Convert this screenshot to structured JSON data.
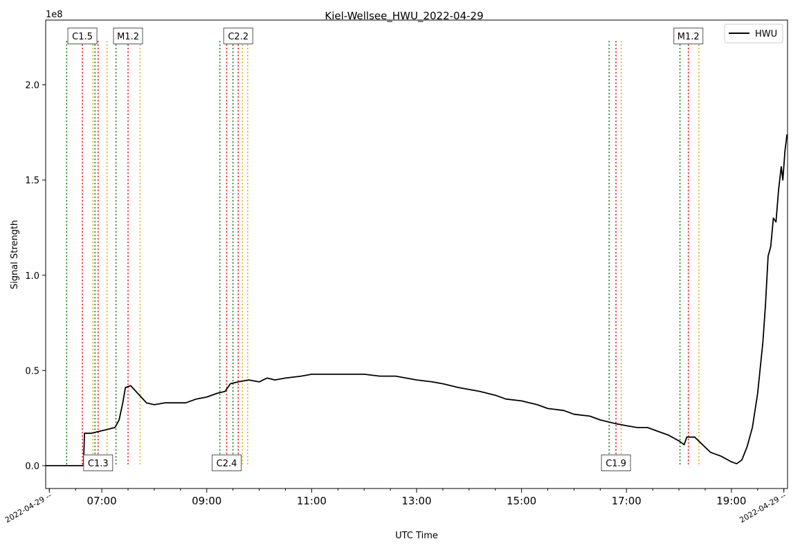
{
  "chart_data": {
    "type": "line",
    "title": "Kiel-Wellsee_HWU_2022-04-29",
    "xlabel": "UTC Time",
    "ylabel": "Signal Strength",
    "y_offset_label": "1e8",
    "xlim": [
      5.93,
      20.07
    ],
    "ylim": [
      -0.12,
      2.34
    ],
    "x_unit": "hour UTC",
    "y_unit": "1e8",
    "grid": false,
    "legend_position": "top-right",
    "x_ticks": [
      {
        "x": 7,
        "label": "07:00"
      },
      {
        "x": 9,
        "label": "09:00"
      },
      {
        "x": 11,
        "label": "11:00"
      },
      {
        "x": 13,
        "label": "13:00"
      },
      {
        "x": 15,
        "label": "15:00"
      },
      {
        "x": 17,
        "label": "17:00"
      },
      {
        "x": 19,
        "label": "19:00"
      }
    ],
    "x_edge_labels": [
      {
        "x": 6.0,
        "label": "2022-04-29 --"
      },
      {
        "x": 20.0,
        "label": "2022-04-29 --"
      }
    ],
    "y_ticks": [
      {
        "y": 0.0,
        "label": "0.0"
      },
      {
        "y": 0.5,
        "label": "0.5"
      },
      {
        "y": 1.0,
        "label": "1.0"
      },
      {
        "y": 1.5,
        "label": "1.5"
      },
      {
        "y": 2.0,
        "label": "2.0"
      }
    ],
    "series": [
      {
        "name": "HWU",
        "color": "#000000",
        "points": [
          [
            5.93,
            0.0
          ],
          [
            6.2,
            0.0
          ],
          [
            6.5,
            0.0
          ],
          [
            6.65,
            0.0
          ],
          [
            6.67,
            0.17
          ],
          [
            6.8,
            0.17
          ],
          [
            6.95,
            0.18
          ],
          [
            7.1,
            0.19
          ],
          [
            7.25,
            0.2
          ],
          [
            7.33,
            0.24
          ],
          [
            7.4,
            0.33
          ],
          [
            7.45,
            0.41
          ],
          [
            7.55,
            0.42
          ],
          [
            7.65,
            0.39
          ],
          [
            7.75,
            0.36
          ],
          [
            7.85,
            0.33
          ],
          [
            8.0,
            0.32
          ],
          [
            8.2,
            0.33
          ],
          [
            8.4,
            0.33
          ],
          [
            8.6,
            0.33
          ],
          [
            8.8,
            0.35
          ],
          [
            9.0,
            0.36
          ],
          [
            9.2,
            0.38
          ],
          [
            9.35,
            0.39
          ],
          [
            9.45,
            0.43
          ],
          [
            9.6,
            0.44
          ],
          [
            9.8,
            0.45
          ],
          [
            10.0,
            0.44
          ],
          [
            10.15,
            0.46
          ],
          [
            10.3,
            0.45
          ],
          [
            10.5,
            0.46
          ],
          [
            10.8,
            0.47
          ],
          [
            11.0,
            0.48
          ],
          [
            11.2,
            0.48
          ],
          [
            11.5,
            0.48
          ],
          [
            11.8,
            0.48
          ],
          [
            12.0,
            0.48
          ],
          [
            12.3,
            0.47
          ],
          [
            12.6,
            0.47
          ],
          [
            12.8,
            0.46
          ],
          [
            13.0,
            0.45
          ],
          [
            13.3,
            0.44
          ],
          [
            13.5,
            0.43
          ],
          [
            13.8,
            0.41
          ],
          [
            14.0,
            0.4
          ],
          [
            14.2,
            0.39
          ],
          [
            14.5,
            0.37
          ],
          [
            14.7,
            0.35
          ],
          [
            15.0,
            0.34
          ],
          [
            15.3,
            0.32
          ],
          [
            15.5,
            0.3
          ],
          [
            15.8,
            0.29
          ],
          [
            16.0,
            0.27
          ],
          [
            16.3,
            0.26
          ],
          [
            16.5,
            0.24
          ],
          [
            16.8,
            0.22
          ],
          [
            17.0,
            0.21
          ],
          [
            17.2,
            0.2
          ],
          [
            17.4,
            0.2
          ],
          [
            17.6,
            0.18
          ],
          [
            17.8,
            0.16
          ],
          [
            18.0,
            0.13
          ],
          [
            18.1,
            0.11
          ],
          [
            18.15,
            0.15
          ],
          [
            18.3,
            0.15
          ],
          [
            18.45,
            0.11
          ],
          [
            18.6,
            0.07
          ],
          [
            18.8,
            0.05
          ],
          [
            19.0,
            0.02
          ],
          [
            19.05,
            0.015
          ],
          [
            19.1,
            0.01
          ],
          [
            19.2,
            0.03
          ],
          [
            19.3,
            0.1
          ],
          [
            19.4,
            0.2
          ],
          [
            19.5,
            0.38
          ],
          [
            19.6,
            0.65
          ],
          [
            19.65,
            0.85
          ],
          [
            19.7,
            1.1
          ],
          [
            19.75,
            1.15
          ],
          [
            19.8,
            1.3
          ],
          [
            19.85,
            1.28
          ],
          [
            19.9,
            1.45
          ],
          [
            19.95,
            1.57
          ],
          [
            19.98,
            1.5
          ],
          [
            20.02,
            1.65
          ],
          [
            20.06,
            1.74
          ]
        ]
      }
    ],
    "event_markers": [
      {
        "label": "C1.5",
        "label_pos": "top",
        "start": 6.33,
        "peak": 6.63,
        "end": 6.83
      },
      {
        "label": "C1.3",
        "label_pos": "bottom",
        "start": 6.87,
        "peak": 6.93,
        "end": 7.1
      },
      {
        "label": "M1.2",
        "label_pos": "top",
        "start": 7.27,
        "peak": 7.5,
        "end": 7.73
      },
      {
        "label": "C2.4",
        "label_pos": "bottom",
        "start": 9.25,
        "peak": 9.38,
        "end": 9.68
      },
      {
        "label": "C2.2",
        "label_pos": "top",
        "start": 9.5,
        "peak": 9.6,
        "end": 9.78
      },
      {
        "label": "C1.9",
        "label_pos": "bottom",
        "start": 16.67,
        "peak": 16.8,
        "end": 16.9
      },
      {
        "label": "M1.2",
        "label_pos": "top",
        "start": 18.02,
        "peak": 18.18,
        "end": 18.38
      }
    ],
    "marker_colors": {
      "start": "#008000",
      "peak": "#ff0000",
      "end": "#d4b000"
    }
  }
}
